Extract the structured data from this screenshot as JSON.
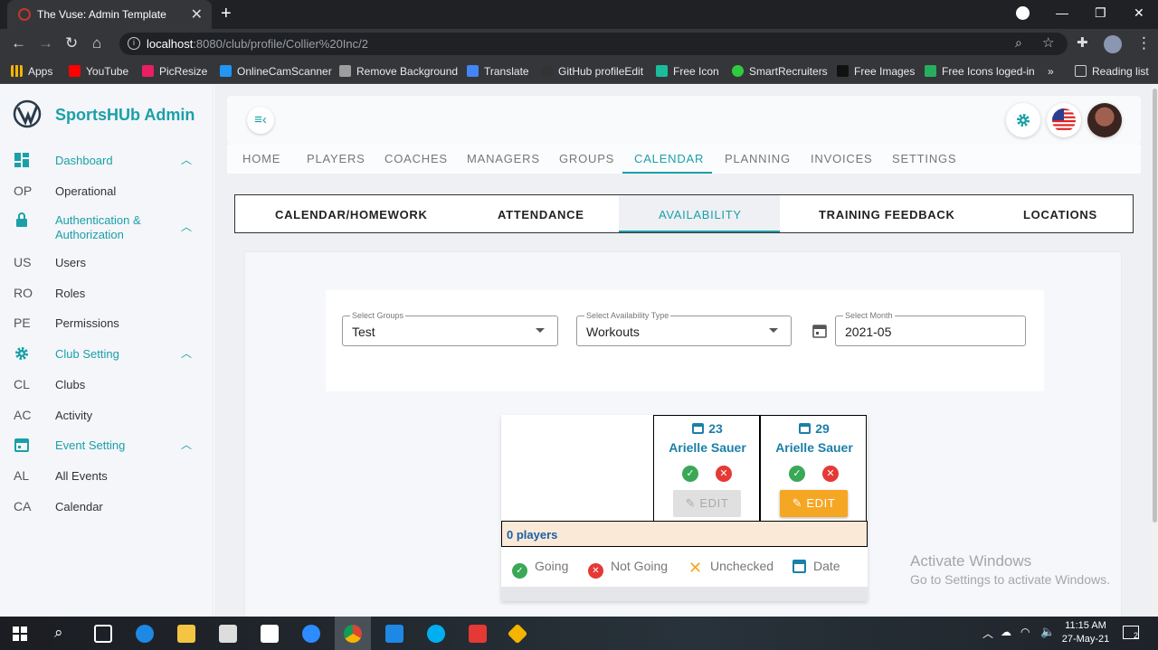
{
  "browser": {
    "tab_title": "The Vuse: Admin Template",
    "url_host": "localhost",
    "url_rest": ":8080/club/profile/Collier%20Inc/2",
    "bookmarks": [
      "Apps",
      "YouTube",
      "PicResize",
      "OnlineCamScanner",
      "Remove Background",
      "Translate",
      "GitHub profileEdit",
      "Free Icon",
      "SmartRecruiters",
      "Free Images",
      "Free Icons loged-in"
    ],
    "overflow": "»",
    "reading_list": "Reading list"
  },
  "app": {
    "name": "SportsHUb Admin"
  },
  "sidebar": {
    "sections": [
      {
        "label": "Dashboard",
        "icon": "dashboard-icon",
        "items": [
          {
            "abbr": "OP",
            "label": "Operational"
          }
        ]
      },
      {
        "label": "Authentication & Authorization",
        "label1": "Authentication &",
        "label2": "Authorization",
        "icon": "lock-icon",
        "items": [
          {
            "abbr": "US",
            "label": "Users"
          },
          {
            "abbr": "RO",
            "label": "Roles"
          },
          {
            "abbr": "PE",
            "label": "Permissions"
          }
        ]
      },
      {
        "label": "Club Setting",
        "icon": "gear-icon",
        "items": [
          {
            "abbr": "CL",
            "label": "Clubs"
          },
          {
            "abbr": "AC",
            "label": "Activity"
          }
        ]
      },
      {
        "label": "Event Setting",
        "icon": "calendar-icon",
        "items": [
          {
            "abbr": "AL",
            "label": "All Events"
          },
          {
            "abbr": "CA",
            "label": "Calendar"
          }
        ]
      }
    ]
  },
  "nav_tabs": [
    "HOME",
    "PLAYERS",
    "COACHES",
    "MANAGERS",
    "GROUPS",
    "CALENDAR",
    "PLANNING",
    "INVOICES",
    "SETTINGS"
  ],
  "active_nav_tab": "CALENDAR",
  "sub_tabs": [
    "CALENDAR/HOMEWORK",
    "ATTENDANCE",
    "AVAILABILITY",
    "TRAINING FEEDBACK",
    "LOCATIONS"
  ],
  "active_sub_tab": "AVAILABILITY",
  "filters": {
    "groups": {
      "caption": "Select Groups",
      "value": "Test"
    },
    "availability_type": {
      "caption": "Select Availability Type",
      "value": "Workouts"
    },
    "month": {
      "caption": "Select Month",
      "value": "2021-05"
    }
  },
  "availability": {
    "columns": [
      {
        "day": "23",
        "name": "Arielle Sauer",
        "edit_label": "EDIT",
        "edit_enabled": false
      },
      {
        "day": "29",
        "name": "Arielle Sauer",
        "edit_label": "EDIT",
        "edit_enabled": true
      }
    ],
    "players_count_text": "0 players",
    "legend": [
      "Going",
      "Not Going",
      "Unchecked",
      "Date"
    ]
  },
  "colors": {
    "accent": "#1ba0a8",
    "edit_active": "#f5a623",
    "going": "#3aa856",
    "not_going": "#e53935",
    "unchecked": "#f5a623"
  },
  "watermark": {
    "line1": "Activate Windows",
    "line2": "Go to Settings to activate Windows."
  },
  "taskbar": {
    "time": "11:15 AM",
    "date": "27-May-21",
    "notif_count": "2"
  }
}
